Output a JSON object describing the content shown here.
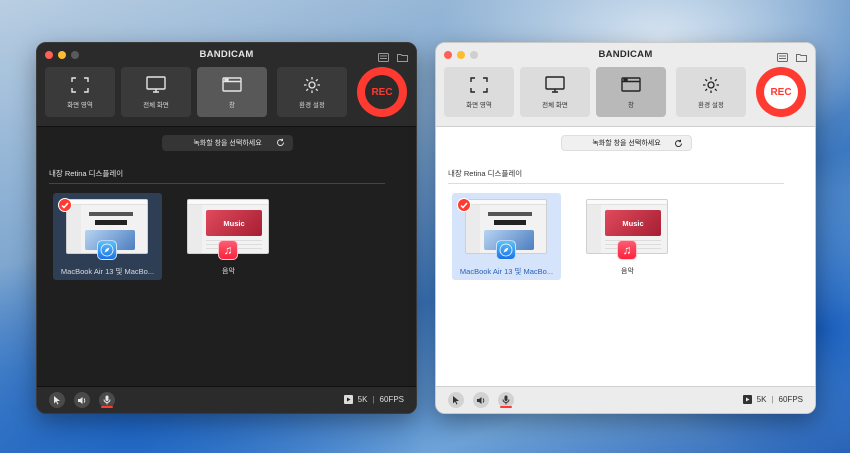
{
  "app_title": "BANDICAM",
  "modes": [
    {
      "label": "화면 영역",
      "icon": "screen-region-icon"
    },
    {
      "label": "전체 화면",
      "icon": "fullscreen-monitor-icon"
    },
    {
      "label": "창",
      "icon": "window-icon",
      "active": true
    },
    {
      "label": "환경 설정",
      "icon": "gear-icon"
    }
  ],
  "rec_label": "REC",
  "select_prompt": "녹화할 창을 선택하세요",
  "section_label": "내장 Retina 디스플레이",
  "thumbnails": [
    {
      "label": "MacBook Air 13 및 MacBo...",
      "app_icon": "safari-icon",
      "selected": true,
      "shot_headline": "날렵하게 날다."
    },
    {
      "label": "음악",
      "app_icon": "music-icon",
      "selected": false,
      "shot_headline": "Music"
    }
  ],
  "bottom": {
    "resolution": "5K",
    "separator": "|",
    "fps": "60FPS"
  },
  "colors": {
    "accent": "#ff3a30",
    "dark_bg": "#1f1f1f",
    "light_bg": "#ffffff"
  }
}
